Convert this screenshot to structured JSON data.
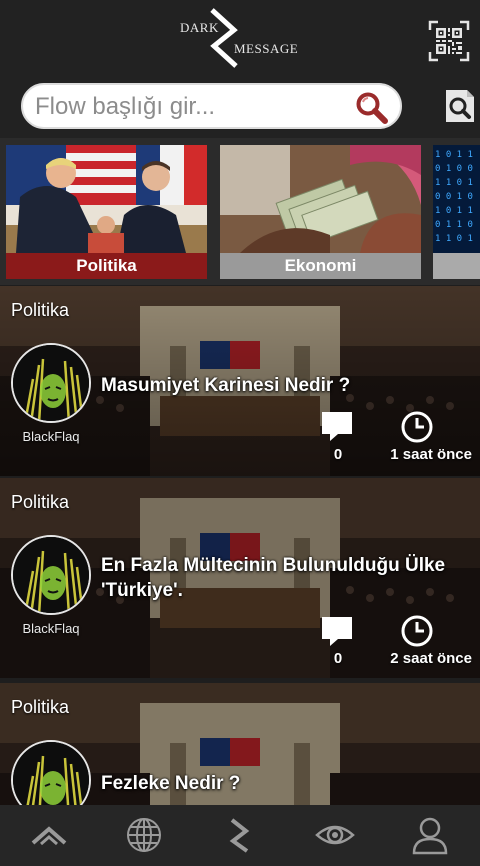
{
  "header": {
    "logo": {
      "word1": "DARK",
      "word2": "MESSAGE"
    },
    "search_placeholder": "Flow başlığı gir...",
    "icons": {
      "qr": "qr-code-icon",
      "search": "magnifier-icon",
      "search_page": "search-page-icon"
    },
    "accent_colors": {
      "search_icon": "#9a2b2b"
    }
  },
  "categories": [
    {
      "label": "Politika",
      "label_color": "#8b1a1a"
    },
    {
      "label": "Ekonomi",
      "label_color": "#9a9a9a"
    },
    {
      "label": "",
      "label_color": "#aaaaaa"
    }
  ],
  "feed": [
    {
      "category": "Politika",
      "author": "BlackFlaq",
      "title": "Masumiyet Karinesi Nedir ?",
      "comments": "0",
      "time": "1 saat önce"
    },
    {
      "category": "Politika",
      "author": "BlackFlaq",
      "title": "En Fazla Mültecinin Bulunulduğu Ülke 'Türkiye'.",
      "comments": "0",
      "time": "2 saat önce"
    },
    {
      "category": "Politika",
      "author": "",
      "title": "Fezleke Nedir ?",
      "comments": "",
      "time": ""
    }
  ],
  "bottom_nav": {
    "items": [
      "home-chevron-icon",
      "globe-icon",
      "logo-icon",
      "eye-icon",
      "profile-icon"
    ]
  }
}
